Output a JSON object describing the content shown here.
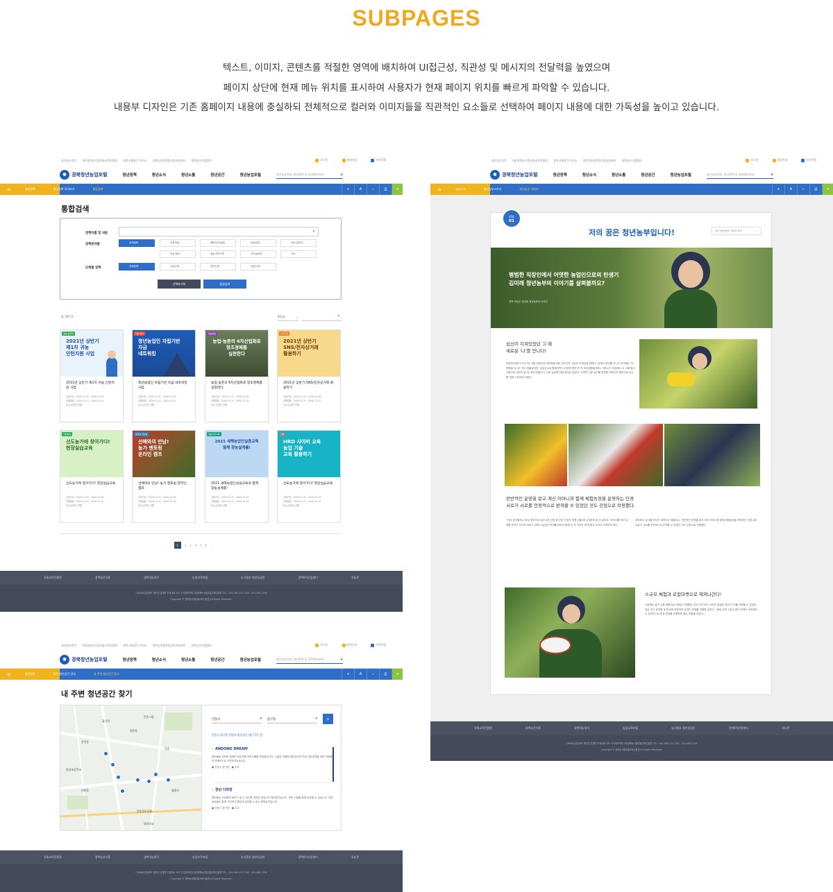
{
  "heading": "SUBPAGES",
  "intro": [
    "텍스트, 이미지, 콘텐츠를  적절한 영역에  배치하여 UI접근성, 직관성 및 메시지의 전달력을 높였으며",
    "페이지 상단에 현재 메뉴 위치를 표시하여 사용자가 현재 페이지 위치를 빠르게 파악할 수 있습니다.",
    "내용부 디자인은 기존 홈페이지 내용에 충실하되 전체적으로 컬러와 이미지들을 직관적인 요소들로 선택하여  페이지 내용에 대한 가독성을 높이고 있습니다."
  ],
  "site": {
    "logo": "경북청년농업포털",
    "util_links": [
      "청년농부인턴",
      "(재)경북농식품유통교육진흥원",
      "경북고향생각 아이소",
      "경북농촌융복합산업지원센터",
      "경북농산식품정보"
    ],
    "login": "로그인",
    "join": "회원가입",
    "sitemap": "사이트맵",
    "menu": [
      "청년정책",
      "청년소식",
      "청년소통",
      "청년공간",
      "청년농업포털"
    ],
    "search_placeholder": "청년농업지원, 청년정책 등 검색해보세요!",
    "tools": [
      "+",
      "A",
      "−"
    ],
    "footer_links": [
      "유통교육진흥원",
      "경북농산식품",
      "경북의농생각",
      "농업교육포털",
      "농식품부 청년농업인",
      "경북6차산업센터",
      "귀농관"
    ],
    "footer_copy": [
      "(36488)경상북도 예천군 호명면 도청대로 455 지식정보타워 (재)경북농식품유통교육진흥원  TEL : 054-460-1111   FAX : 054-460-1199",
      "Copyright © 경북농식품유통교육진흥원 All Rights Reserved."
    ]
  },
  "search_page": {
    "crumb": [
      "청년정책",
      "청년정책 모아보기",
      "통합검색"
    ],
    "title": "통합검색",
    "label_keyword": "정책이름 및 내용",
    "label_field": "정책분야별",
    "label_stage": "단계별 정책",
    "all": "전체정책",
    "fields": [
      "교육과정",
      "멘토링·컨설팅",
      "창농창업",
      "귀농·일자리",
      "자금·융자",
      "청농기반구축",
      "선도농육성",
      "기타"
    ],
    "stages": [
      "전체정책",
      "진입단계",
      "정착단계",
      "성장단계"
    ],
    "btn_reset": "선택초기화",
    "btn_search": "통합검색",
    "total": "총  195 건",
    "sort": "최신순",
    "cards": [
      {
        "tag": "귀농·일자리",
        "img_title": "2021년 상반기\n제1차 귀농\n인턴지원 사업",
        "title": "2021년 상반기 제1차 귀농 인턴지원 사업",
        "d1": "신청기간  · 2020.11.31 - 2020.12.18",
        "d2": "진행일정  · 2020.12.21 - 2020.12.31",
        "loc": "경    A  온라인 진행"
      },
      {
        "tag": "자금·융자",
        "img_title": "청년농업인 자립기반\n자금\n네트워킹",
        "title": "청년농업인 자립기반 자금 네트워킹 사업",
        "d1": "신청기간  · 2020.11.31 - 2020.12.18",
        "d2": "진행일정  · 2020.12.21 - 2020.12.31",
        "loc": "경    A  온라인 진행"
      },
      {
        "tag": "창농창업",
        "img_title": "농업·농촌의 6차산업화로\n창조경제를\n실현한다",
        "title": "농업·농촌의 6차산업화로 창조경제를 실현한다.",
        "d1": "신청기간  · 2020.11.31 - 2020.12.18",
        "d2": "진행일정  · 2020.12.21 - 2020.12.31",
        "loc": "경    A  온라인 진행"
      },
      {
        "tag": "교육과정",
        "img_title": "2021년 상반기\nSNS/전자상거래\n활용하기",
        "title": "2021년 상반기 SNS/전자상거래 활용하기",
        "d1": "신청기간  · 2020.11.31 - 2020.12.18",
        "d2": "진행일정  · 2020.12.21 - 2020.12.31",
        "loc": "경    A  온라인 진행"
      },
      {
        "tag": "기타분야",
        "img_title": "선도농가에 찾아가다!\n현장실습교육",
        "title": "선도농가에 찾아가다! 현장실습교육",
        "d1": "신청기간  · 2020.11.31 - 2020.12.18",
        "d2": "진행일정  · 2020.12.21 - 2020.12.31",
        "loc": "경    A  온라인 진행"
      },
      {
        "tag": "멘토링·컨설팅",
        "img_title": "선배와의 만남!\n농가 멘토링\n온라인 캠프",
        "title": "선배와의 만남! 농가 멘토링 온라인 캠프",
        "d1": "신청기간  · 2020.11.31 - 2020.12.18",
        "d2": "진행일정  · 2020.12.21 - 2020.12.31",
        "loc": "경    A  온라인 진행"
      },
      {
        "tag": "청농기반구축",
        "img_title": "2021 새해농업인실용교육\n함께 창농설계를!",
        "title": "2021 새해농업인실용교육과 함께 창농설계를!",
        "d1": "신청기간  · 2020.11.31 - 2020.12.18",
        "d2": "진행일정  · 2020.12.21 - 2020.12.31",
        "loc": "경    A  온라인 진행"
      },
      {
        "tag": "기타",
        "img_title": "HRD 사이버 교육\n농업 기술\n교육 활용하기",
        "title": "선도농가에 찾아가다! 현장실습교육",
        "d1": "신청기간  · 2020.11.31 - 2020.12.18",
        "d2": "진행일정  · 2020.12.21 - 2020.12.31",
        "loc": "경    A  온라인 진행"
      }
    ],
    "pages": [
      "‹",
      "1",
      "2",
      "3",
      "4",
      "5",
      "6",
      "›"
    ]
  },
  "space_page": {
    "crumb": [
      "청년공간",
      "경북 청년공간 안내",
      "내 주변 청년공간 찾기"
    ],
    "title": "내 주변 청년공간 찾기",
    "sel1": "안동시",
    "sel2": "중구동",
    "result": "안동시 중구동 주변의 청년공간 (총  171 건)",
    "items": [
      {
        "name": "ANDONG DREAM",
        "desc": "청년들을 위하여 특화된 창업지원 프로그램을 운영중입니다. 시설은 카페형 열린공간과 프로그램 운영을 위한 미팅룸과 판매부스로 구성되어있습니다.",
        "addr": "안동시 중구동",
        "tag": "주요"
      },
      {
        "name": "청년 다락방",
        "desc": "청년들이 자유롭게 꿈꾸고 놀 수 있도록 마련된 커뮤니티 청년공간입니다. 편히 시설을 함께 공유할 수 있습니다. 청년농부들이 함께 고민하고 즐겁게 공유할 수 있는 문화공간입니다.",
        "addr": "안동시 중구동",
        "tag": "주요"
      }
    ],
    "map_labels": [
      "안동시청",
      "월곡면",
      "운안동",
      "중앙초등학교",
      "옥동",
      "법흥리",
      "안동웅부공원",
      "태화동",
      "명륜동",
      "영호대교"
    ]
  },
  "story_page": {
    "crumb": [
      "청년소식",
      "청년농부스토리",
      "청년농부 이야기"
    ],
    "vol": "VOL",
    "vol_no": "01",
    "title": "저의 꿈은 청년농부입니다!",
    "select": "지난 청년농부 이야기 보기",
    "hero_text": "평범한 직장인에서 어엿한 농업인으로의 탄생기\n김미래 청년농부의 이야기를 살펴볼까요?",
    "hero_sub": "경북 의성군 김미래 청년농부의 이야기",
    "s1_title": "심신이 지쳐있었던 그 때\n새로운 '나'를 만나다!",
    "s1_body": "김미래 대표가 2017년 가을 의성으로 내려왔을 때는 아무것도 심신이 지쳐있을 때였다. 낯게는 회사를 다니고 저녁에는 대학원을 다니는 것도 힘들었지만, 온실선수로 활동하면서 다양한 활약 한 직 취미생활을 했다. 어머니가 의성에서 소 식해 형사 고향으로 내려가 딸 세 계속 마음만 다 다아 농업에 대한 생각은 없었다. 우연히 이웃 농가를 방문한 어머니의 제안으로 농사를 처음 시작하게 되었다.",
    "s2_title": "전반적인 운영을 맡고 계신 어머니와 함께 체험농장을 운영하는 민경\n서로가 서로를 안정적으로 받쳐줄 수 있었던 것도 강점으로 작용했다.",
    "s2_body_l": "\"저금 생각해보니 여성 청년이나 농업 6차 산업 등 관련 산업의 흐름 있을 때 시작하게 된 것 같아요. 어머니를 따라 교육을 받거나 다니도 하여고 어머니 농업인 직계를 하며서 함께 온 후 지켜도 하게 해서 주어서 다양하게 하다.\"",
    "s2_body_r": "부여에서 농사를 하다가 내려오신 외할머니, 전반적인 운영을 맡고 계신 어머니와 함께 체험농장을 운영하는 민경 씨는 서로가 서로를 안정적으로 받쳐줄 수 있었던 것도 강점으로 작용했다.",
    "s3_title": "소규모 체험과 로컬마켓으로 헤쳐나간다!",
    "s3_body": "기존에는 딸기 수확 체험으로 대부분 수확했던 것이 여기 보는 사태가 발생한 것이다. 이를 극복할 수 있었던 것은 인근 유치원 및 학교에 방문하여 온라인 판매를 진행한 것이다. \"동네 지역 시장이 없어 판매가 어려웠으나 온라인으로 현상 판매를 진행하며 좋은 반응을 얻었다.\""
  }
}
